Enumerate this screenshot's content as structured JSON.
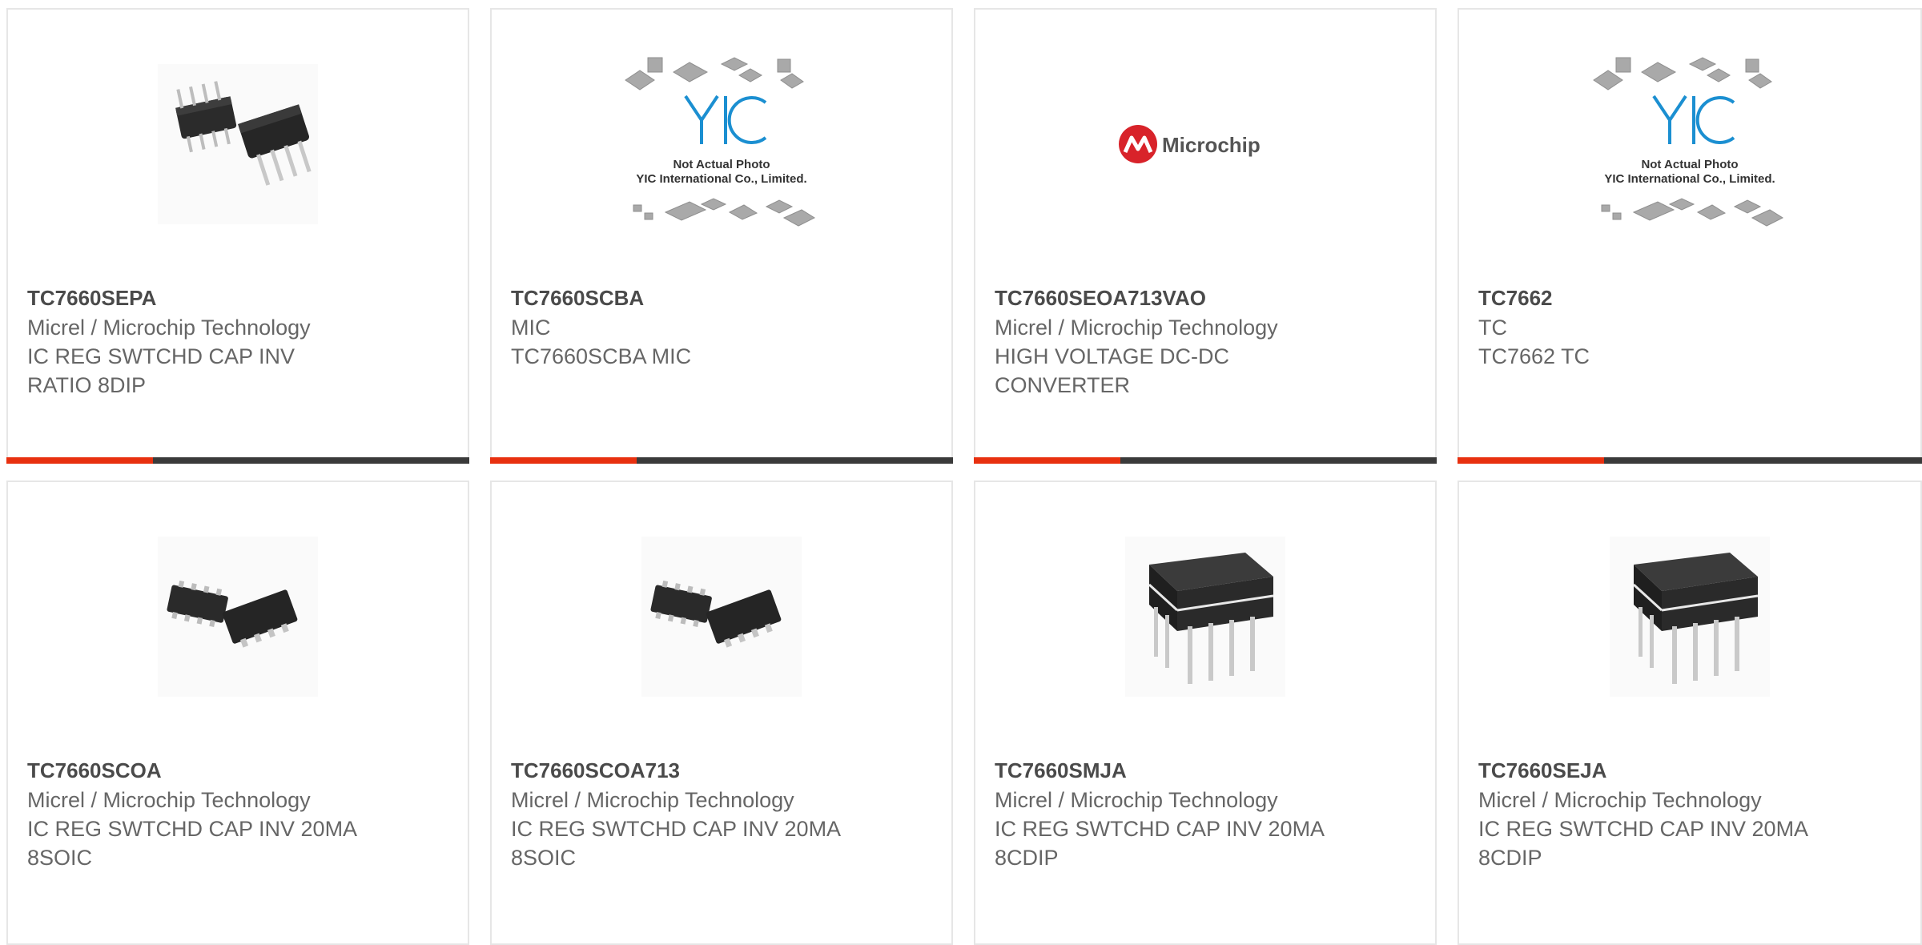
{
  "colors": {
    "accent": "#e8300f",
    "bar": "#3a3a3a",
    "title": "#4a4a4a",
    "text": "#666666",
    "brand_red": "#d8232a",
    "yic_blue": "#1b8fd1"
  },
  "products": [
    {
      "part": "TC7660SEPA",
      "manufacturer": "Micrel / Microchip Technology",
      "description": "IC REG SWTCHD CAP INV RATIO 8DIP",
      "image": "dip8-chip-photo"
    },
    {
      "part": "TC7660SCBA",
      "manufacturer": "MIC",
      "description": "TC7660SCBA MIC",
      "image": "yic-placeholder",
      "placeholder_lines": [
        "Not Actual Photo",
        "YIC International Co., Limited."
      ]
    },
    {
      "part": "TC7660SEOA713VAO",
      "manufacturer": "Micrel / Microchip Technology",
      "description": "HIGH VOLTAGE DC-DC CONVERTER",
      "image": "microchip-logo",
      "logo_text": "Microchip"
    },
    {
      "part": "TC7662",
      "manufacturer": "TC",
      "description": "TC7662 TC",
      "image": "yic-placeholder",
      "placeholder_lines": [
        "Not Actual Photo",
        "YIC International Co., Limited."
      ]
    },
    {
      "part": "TC7660SCOA",
      "manufacturer": "Micrel / Microchip Technology",
      "description": "IC REG SWTCHD CAP INV 20MA 8SOIC",
      "image": "soic8-chip-photo"
    },
    {
      "part": "TC7660SCOA713",
      "manufacturer": "Micrel / Microchip Technology",
      "description": "IC REG SWTCHD CAP INV 20MA 8SOIC",
      "image": "soic8-chip-photo"
    },
    {
      "part": "TC7660SMJA",
      "manufacturer": "Micrel / Microchip Technology",
      "description": "IC REG SWTCHD CAP INV 20MA 8CDIP",
      "image": "cdip8-chip-photo"
    },
    {
      "part": "TC7660SEJA",
      "manufacturer": "Micrel / Microchip Technology",
      "description": "IC REG SWTCHD CAP INV 20MA 8CDIP",
      "image": "cdip8-chip-photo"
    }
  ]
}
